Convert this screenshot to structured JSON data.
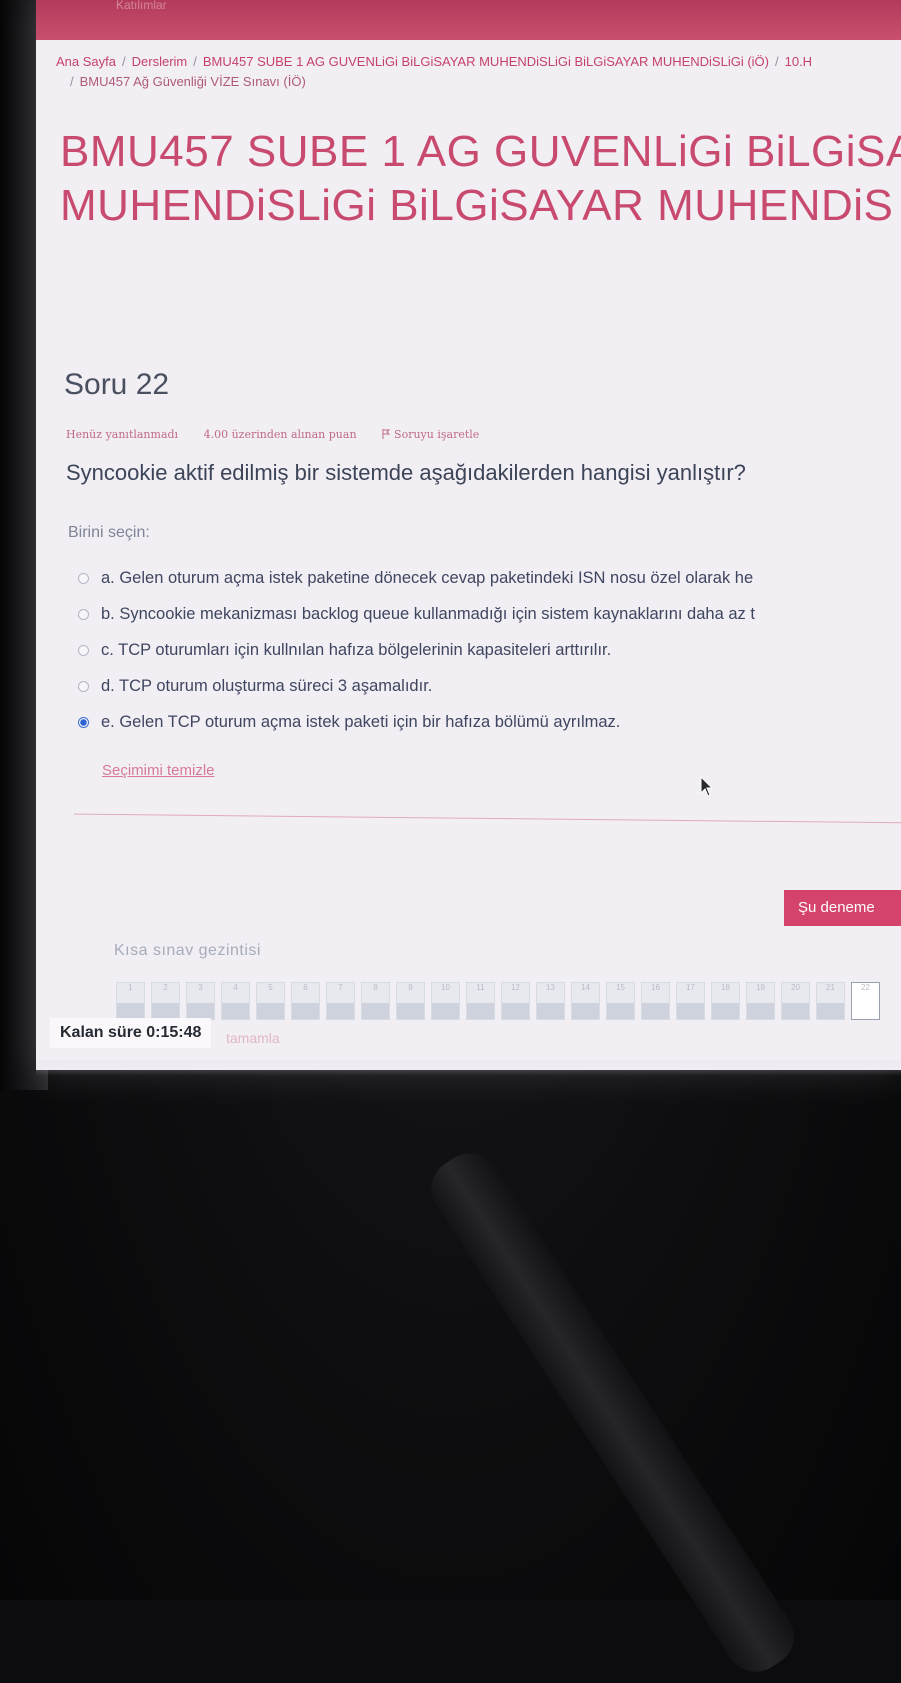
{
  "topbar": {
    "faint_text": "Katılımlar"
  },
  "breadcrumb": {
    "items": [
      "Ana Sayfa",
      "Derslerim",
      "BMU457 SUBE 1 AG GUVENLiGi BiLGiSAYAR MUHENDiSLiGi BiLGiSAYAR MUHENDiSLiGi (iÖ)",
      "10.H",
      "BMU457 Ağ Güvenliği VİZE Sınavı (İÖ)"
    ],
    "separator": "/"
  },
  "course_title": {
    "line1": "BMU457 SUBE 1 AG GUVENLiGi BiLGiSA",
    "line2": "MUHENDiSLiGi BiLGiSAYAR MUHENDiS"
  },
  "question": {
    "title": "Soru 22",
    "status": "Henüz yanıtlanmadı",
    "points": "4.00 üzerinden alınan puan",
    "flag_label": "Soruyu işaretle",
    "text": "Syncookie aktif edilmiş bir sistemde aşağıdakilerden hangisi yanlıştır?",
    "choose_label": "Birini seçin:",
    "answers": [
      {
        "label": "a. Gelen oturum açma istek paketine dönecek cevap paketindeki ISN nosu özel olarak he",
        "selected": false
      },
      {
        "label": "b. Syncookie mekanizması backlog queue kullanmadığı için sistem kaynaklarını daha az t",
        "selected": false
      },
      {
        "label": "c. TCP oturumları için kullnılan hafıza bölgelerinin kapasiteleri arttırılır.",
        "selected": false
      },
      {
        "label": "d. TCP oturum oluşturma süreci 3 aşamalıdır.",
        "selected": false
      },
      {
        "label": "e. Gelen TCP oturum açma istek paketi için bir hafıza bölümü ayrılmaz.",
        "selected": true
      }
    ],
    "clear_label": "Seçimimi temizle"
  },
  "next_button": "Şu deneme",
  "navigation": {
    "title": "Kısa sınav gezintisi",
    "buttons": [
      "1",
      "2",
      "3",
      "4",
      "5",
      "6",
      "7",
      "8",
      "9",
      "10",
      "11",
      "12",
      "13",
      "14",
      "15",
      "16",
      "17",
      "18",
      "19",
      "20",
      "21",
      "22"
    ],
    "current": "22"
  },
  "timer": {
    "label": "Kalan süre",
    "value": "0:15:48"
  },
  "finish_label": "tamamla",
  "colors": {
    "accent": "#d4436c",
    "title": "#c84a6e",
    "selected_radio": "#2c63d4"
  }
}
